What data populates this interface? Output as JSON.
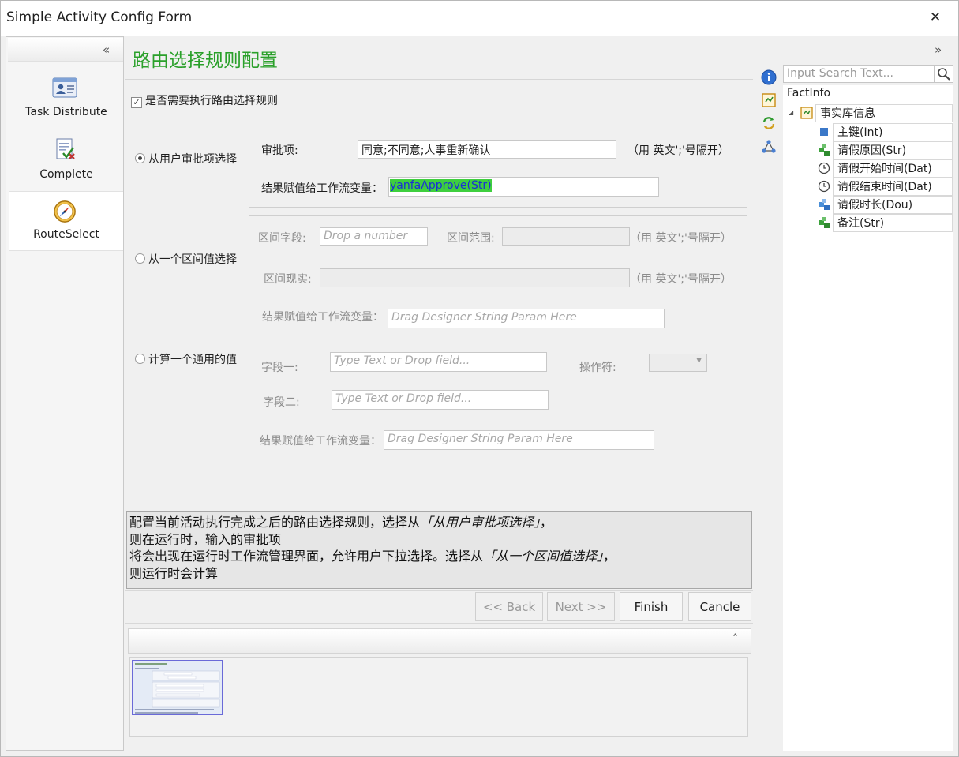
{
  "window": {
    "title": "Simple Activity Config Form",
    "close_glyph": "✕"
  },
  "nav": {
    "collapse_glyph": "«",
    "items": [
      {
        "label": "Task Distribute",
        "icon": "user-card-icon"
      },
      {
        "label": "Complete",
        "icon": "document-check-icon"
      },
      {
        "label": "RouteSelect",
        "icon": "compass-icon"
      }
    ]
  },
  "main": {
    "title": "路由选择规则配置",
    "enable_rule": {
      "label": "是否需要执行路由选择规则",
      "checked": true
    },
    "option1": {
      "label": "从用户审批项选择",
      "selected": true,
      "approval_label": "审批项:",
      "approval_value": "同意;不同意;人事重新确认",
      "approval_hint": "（用 英文';'号隔开）",
      "result_label": "结果赋值给工作流变量：",
      "result_value": "yanfaApprove(Str)"
    },
    "option2": {
      "label": "从一个区间值选择",
      "selected": false,
      "field_label": "区间字段:",
      "field_placeholder": "Drop a number",
      "range_label": "区间范围:",
      "range_hint": "（用 英文';'号隔开）",
      "actual_label": "区间现实:",
      "actual_hint": "（用 英文';'号隔开）",
      "result_label": "结果赋值给工作流变量：",
      "result_placeholder": "Drag Designer String Param Here"
    },
    "option3": {
      "label": "计算一个通用的值",
      "selected": false,
      "field1_label": "字段一:",
      "field1_placeholder": "Type Text or Drop field...",
      "operator_label": "操作符:",
      "field2_label": "字段二:",
      "field2_placeholder": "Type Text or Drop field...",
      "result_label": "结果赋值给工作流变量：",
      "result_placeholder": "Drag Designer String Param Here"
    },
    "description": {
      "line1_a": "配置当前活动执行完成之后的路由选择规则，选择从",
      "line1_em": "「从用户审批项选择」",
      "line1_b": "，",
      "line2": "则在运行时，输入的审批项",
      "line3_a": "将会出现在运行时工作流管理界面，允许用户下拉选择。选择从",
      "line3_em": "「从一个区间值选择」",
      "line3_b": "，",
      "line4": "则运行时会计算"
    },
    "buttons": {
      "back": "<< Back",
      "next": "Next >>",
      "finish": "Finish",
      "cancel": "Cancle"
    },
    "preview_chevron": "˄"
  },
  "right": {
    "collapse_glyph": "»",
    "search_placeholder": "Input Search Text...",
    "tree_title": "FactInfo",
    "root": {
      "label": "事实库信息",
      "expand_glyph": "◢"
    },
    "children": [
      {
        "label": "主键(Int)",
        "icon": "square-icon"
      },
      {
        "label": "请假原因(Str)",
        "icon": "green-blocks-icon"
      },
      {
        "label": "请假开始时间(Dat)",
        "icon": "clock-icon"
      },
      {
        "label": "请假结束时间(Dat)",
        "icon": "clock-icon"
      },
      {
        "label": "请假时长(Dou)",
        "icon": "blue-blocks-icon"
      },
      {
        "label": "备注(Str)",
        "icon": "green-blocks-icon"
      }
    ]
  }
}
